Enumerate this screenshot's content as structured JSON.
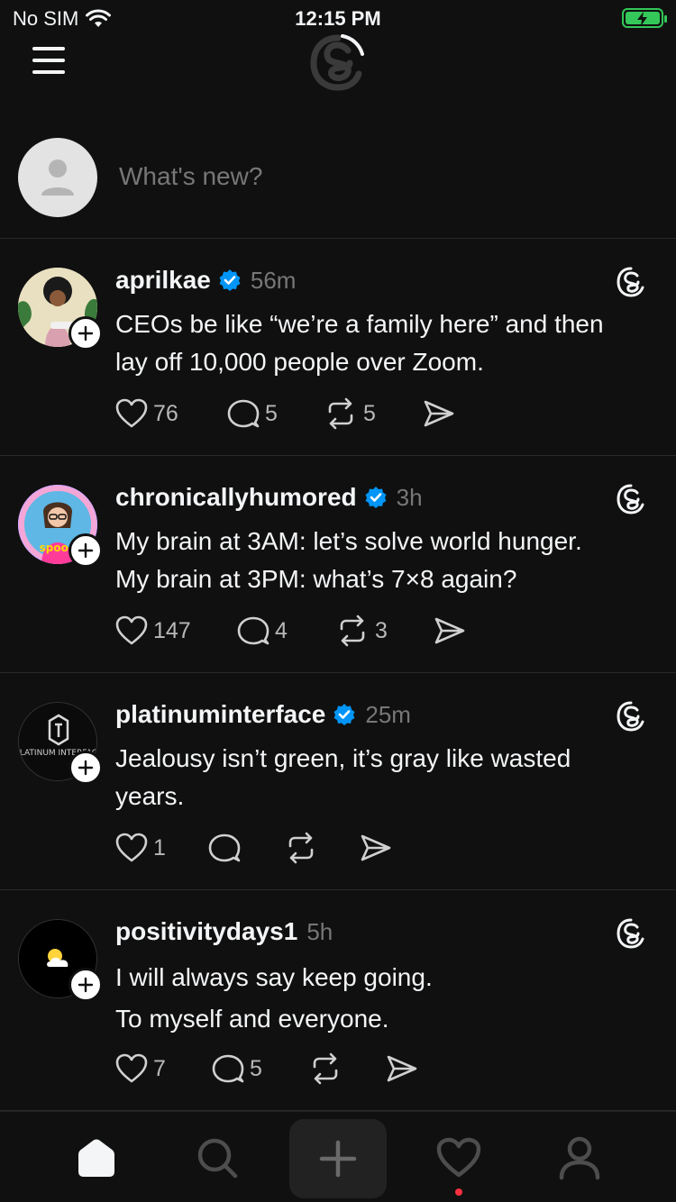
{
  "status_bar": {
    "carrier": "No SIM",
    "time": "12:15 PM"
  },
  "composer": {
    "placeholder": "What's new?"
  },
  "posts": [
    {
      "username": "aprilkae",
      "verified": true,
      "time": "56m",
      "lines": [
        "CEOs be like “we’re a family here” and then",
        "lay off 10,000 people over Zoom."
      ],
      "likes": "76",
      "replies": "5",
      "reposts": "5"
    },
    {
      "username": "chronicallyhumored",
      "verified": true,
      "time": "3h",
      "lines": [
        "My brain at 3AM: let’s solve world hunger.",
        "My brain at 3PM: what’s 7×8 again?"
      ],
      "likes": "147",
      "replies": "4",
      "reposts": "3"
    },
    {
      "username": "platinuminterface",
      "verified": true,
      "time": "25m",
      "lines": [
        "Jealousy isn’t green, it’s gray like wasted",
        "years."
      ],
      "likes": "1",
      "replies": "",
      "reposts": "",
      "avatar_text": "PLATINUM INTERFACE"
    },
    {
      "username": "positivitydays1",
      "verified": false,
      "time": "5h",
      "lines": [
        "I will always say keep going.",
        "To myself and everyone."
      ],
      "likes": "7",
      "replies": "5",
      "reposts": ""
    }
  ],
  "icons": {
    "menu": "hamburger-icon",
    "logo": "threads-logo",
    "like": "heart-icon",
    "reply": "comment-icon",
    "repost": "repost-icon",
    "share": "send-icon",
    "home": "home-icon",
    "search": "search-icon",
    "create": "plus-icon",
    "activity": "heart-icon",
    "profile": "person-icon"
  },
  "colors": {
    "background": "#101010",
    "verified": "#0095f6",
    "battery": "#34c759",
    "notification_dot": "#ff3040"
  }
}
